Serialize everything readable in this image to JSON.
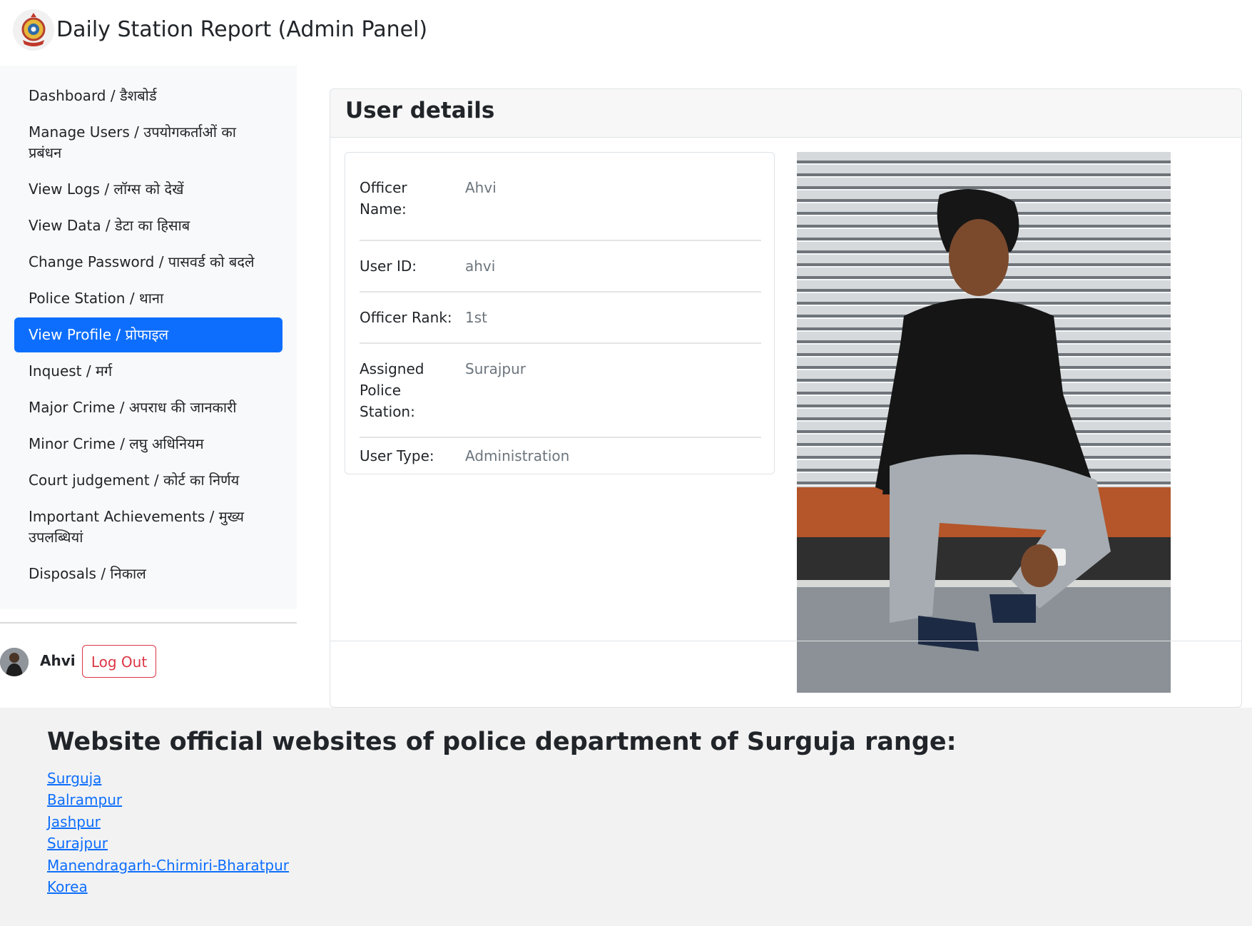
{
  "header": {
    "title": "Daily Station Report (Admin Panel)"
  },
  "sidebar": {
    "items": [
      {
        "label": "Dashboard / डैशबोर्ड"
      },
      {
        "label": "Manage Users / उपयोगकर्ताओं का प्रबंधन"
      },
      {
        "label": "View Logs / लॉग्स को देखें"
      },
      {
        "label": "View Data / डेटा का हिसाब"
      },
      {
        "label": "Change Password / पासवर्ड को बदले"
      },
      {
        "label": "Police Station / थाना"
      },
      {
        "label": "View Profile / प्रोफाइल",
        "active": true
      },
      {
        "label": "Inquest / मर्ग"
      },
      {
        "label": "Major Crime / अपराध की जानकारी"
      },
      {
        "label": "Minor Crime / लघु अधिनियम"
      },
      {
        "label": "Court judgement / कोर्ट का निर्णय"
      },
      {
        "label": "Important Achievements / मुख्य उपलब्धियां"
      },
      {
        "label": "Disposals / निकाल"
      }
    ],
    "user": {
      "name": "Ahvi",
      "logout_label": "Log Out"
    }
  },
  "main": {
    "card_title": "User details",
    "details": [
      {
        "label": "Officer Name:",
        "value": "Ahvi"
      },
      {
        "label": "User ID:",
        "value": "ahvi"
      },
      {
        "label": "Officer Rank:",
        "value": "1st"
      },
      {
        "label": "Assigned Police Station:",
        "value": "Surajpur"
      },
      {
        "label": "User Type:",
        "value": "Administration"
      }
    ]
  },
  "footer": {
    "title": "Website official websites of police department of Surguja range:",
    "links": [
      "Surguja",
      "Balrampur",
      "Jashpur",
      "Surajpur",
      "Manendragarh-Chirmiri-Bharatpur",
      "Korea"
    ]
  },
  "colors": {
    "primary": "#0d6efd",
    "danger": "#dc3545",
    "sidebar_bg": "#f8f9fa",
    "footer_bg": "#f2f2f2"
  }
}
